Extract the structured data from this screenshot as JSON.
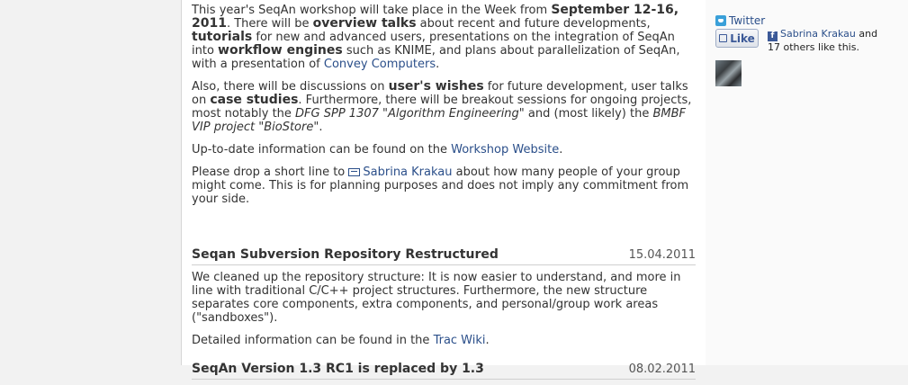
{
  "workshop": {
    "p1_a": "This year's SeqAn workshop will take place in the Week from ",
    "p1_b_dates": "September 12-16, 2011",
    "p1_c": ". There will be ",
    "p1_d_overview": "overview talks",
    "p1_e": " about recent and future developments, ",
    "p1_f_tutorials": "tutorials",
    "p1_g": " for new and advanced users, presentations on the integration of SeqAn into ",
    "p1_h_workflow": "workflow engines",
    "p1_i": " such as KNIME, and plans about parallelization of SeqAn, with a presentation of ",
    "p1_link_convey": "Convey Computers",
    "p1_end": ".",
    "p2_a": "Also, there will be discussions on ",
    "p2_b_wishes": "user's wishes",
    "p2_c": " for future development, user talks on ",
    "p2_d_case": "case studies",
    "p2_e": ". Furthermore, there will be breakout sessions for ongoing projects, most notably the ",
    "p2_f_dfg": "DFG SPP 1307 \"Algorithm Engineering\"",
    "p2_g": " and (most likely) the ",
    "p2_h_bmbf": "BMBF VIP project \"BioStore\"",
    "p2_end": ".",
    "p3_a": "Up-to-date information can be found on the ",
    "p3_link": "Workshop Website",
    "p3_end": ".",
    "p4_a": "Please drop a short line to ",
    "p4_link": "Sabrina Krakau",
    "p4_b": " about how many people of your group might come. This is for planning purposes and does not imply any commitment from your side."
  },
  "news": [
    {
      "title": "Seqan Subversion Repository Restructured",
      "date": "15.04.2011",
      "body": "We cleaned up the repository structure: It is now easier to understand, and more in line with traditional C/C++ project structures. Furthermore, the new structure separates core components, extra components, and personal/group work areas (\"sandboxes\").",
      "detail_a": "Detailed information can be found in the ",
      "detail_link": "Trac Wiki",
      "detail_end": "."
    },
    {
      "title": "SeqAn Version 1.3 RC1 is replaced by 1.3",
      "date": "08.02.2011"
    }
  ],
  "sidebar": {
    "twitter_label": "Twitter",
    "like_label": "Like",
    "fb_icon_letter": "f",
    "fb_name": "Sabrina Krakau",
    "fb_text_a": " and",
    "fb_text_b": "17 others like this."
  },
  "colors": {
    "link": "#2b4f8a",
    "facebook": "#3b5998",
    "twitter": "#3aa0d9"
  }
}
